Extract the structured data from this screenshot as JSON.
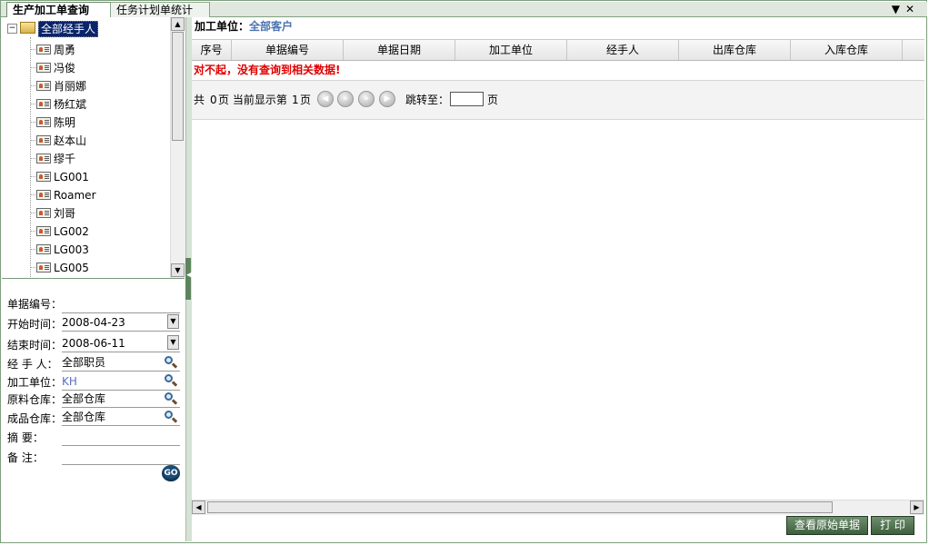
{
  "tabs": [
    {
      "label": "生产加工单查询"
    },
    {
      "label": "任务计划单统计"
    }
  ],
  "window_controls": {
    "menu": "▼",
    "close": "✕"
  },
  "tree": {
    "root": "全部经手人",
    "items": [
      "周勇",
      "冯俊",
      "肖丽娜",
      "杨红斌",
      "陈明",
      "赵本山",
      "缪千",
      "LG001",
      "Roamer",
      "刘哥",
      "LG002",
      "LG003",
      "LG005"
    ]
  },
  "form": {
    "doc_no": {
      "label": "单据编号：",
      "value": ""
    },
    "start_time": {
      "label": "开始时间：",
      "value": "2008-04-23"
    },
    "end_time": {
      "label": "结束时间：",
      "value": "2008-06-11"
    },
    "handler": {
      "label": "经 手 人：",
      "value": "全部职员"
    },
    "proc_unit": {
      "label": "加工单位：",
      "value": "KH"
    },
    "raw_store": {
      "label": "原料仓库：",
      "value": "全部仓库"
    },
    "finished_store": {
      "label": "成品仓库：",
      "value": "全部仓库"
    },
    "summary": {
      "label": "摘    要：",
      "value": ""
    },
    "remark": {
      "label": "备    注：",
      "value": ""
    },
    "go_label": "GO"
  },
  "main": {
    "unit_label": "加工单位：",
    "unit_value": "全部客户",
    "columns": [
      "序号",
      "单据编号",
      "单据日期",
      "加工单位",
      "经手人",
      "出库仓库",
      "入库仓库"
    ],
    "empty_message": "对不起，没有查询到相关数据!"
  },
  "pager": {
    "total_prefix": "共",
    "total_pages": "0",
    "total_suffix": "页 当前显示第",
    "current_page": "1",
    "current_suffix": "页",
    "jump_label": "跳转至：",
    "jump_suffix": "页"
  },
  "buttons": {
    "view_original": "查看原始单据",
    "print": "打 印"
  },
  "colors": {
    "accent": "#5d845d",
    "selection": "#0a246a",
    "error": "#e00000"
  }
}
